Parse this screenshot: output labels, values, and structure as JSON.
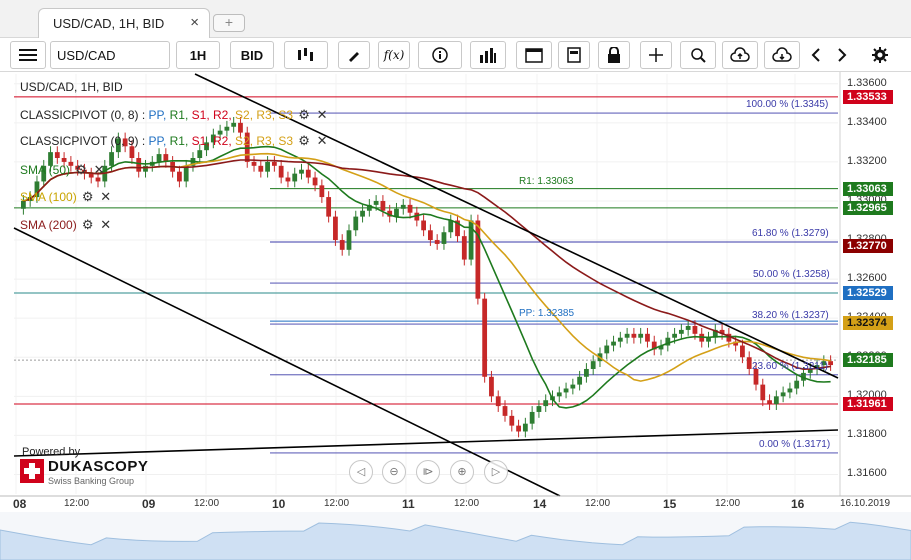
{
  "tab": {
    "label": "USD/CAD, 1H, BID",
    "close": "×",
    "add": "+"
  },
  "toolbar": {
    "instrument": "USD/CAD",
    "period": "1H",
    "side": "BID",
    "fx_label": "f(x)"
  },
  "legend": {
    "title": "USD/CAD, 1H, BID",
    "pivot1_name": "CLASSICPIVOT (0, 8)",
    "pivot2_name": "CLASSICPIVOT (0, 9)",
    "pivot_items": [
      "PP",
      "R1",
      "S1",
      "R2",
      "S2",
      "R3",
      "S3"
    ],
    "sma50": "SMA (50)",
    "sma100": "SMA (100)",
    "sma200": "SMA (200)"
  },
  "branding": {
    "powered_by": "Powered by",
    "brand": "DUKASCOPY",
    "sub": "Swiss Banking Group"
  },
  "annotations": {
    "fib100": "100.00 % (1.3345)",
    "fib618": "61.80 % (1.3279)",
    "fib50": "50.00 % (1.3258)",
    "fib382": "38.20 % (1.3237)",
    "fib236": "23.60 % (1.3211)",
    "fib0": "0.00 % (1.3171)",
    "r1": "R1: 1.33063",
    "pp": "PP: 1.32385"
  },
  "chart_data": {
    "type": "line",
    "title": "USD/CAD, 1H, BID",
    "ylim": [
      1.315,
      1.3365
    ],
    "y_ticks": [
      1.336,
      1.334,
      1.332,
      1.33,
      1.328,
      1.326,
      1.324,
      1.322,
      1.32,
      1.318,
      1.316
    ],
    "y_tick_labels": [
      "1.33600",
      "1.33400",
      "1.33200",
      "1.33000",
      "1.32800",
      "1.32600",
      "1.32400",
      "1.32200",
      "1.32000",
      "1.31800",
      "1.31600"
    ],
    "x_labels": [
      "08",
      "12:00",
      "09",
      "12:00",
      "10",
      "12:00",
      "11",
      "12:00",
      "14",
      "12:00",
      "15",
      "12:00",
      "16",
      "16.10.2019"
    ],
    "price_tags": [
      {
        "value": "1.33533",
        "color": "#d0021b"
      },
      {
        "value": "1.33063",
        "color": "#1e7a1e"
      },
      {
        "value": "1.32965",
        "color": "#1e7a1e"
      },
      {
        "value": "1.32770",
        "color": "#8b0000"
      },
      {
        "value": "1.32529",
        "color": "#1f6fc2"
      },
      {
        "value": "1.32374",
        "color": "#d4a017"
      },
      {
        "value": "1.32185",
        "color": "#1e7a1e"
      },
      {
        "value": "1.31961",
        "color": "#d0021b"
      }
    ],
    "levels": {
      "red_line": 1.33533,
      "r1": 1.33063,
      "green_line": 1.32965,
      "teal_line": 1.32529,
      "pp": 1.32385,
      "red_low": 1.31961
    },
    "fib": [
      1.3345,
      1.3279,
      1.3258,
      1.3237,
      1.3211,
      1.3171
    ],
    "close_series": [
      1.33,
      1.3302,
      1.331,
      1.3318,
      1.3325,
      1.3322,
      1.332,
      1.3318,
      1.3316,
      1.3314,
      1.3312,
      1.331,
      1.3318,
      1.3325,
      1.3332,
      1.3328,
      1.3322,
      1.3315,
      1.3318,
      1.332,
      1.3324,
      1.332,
      1.3315,
      1.331,
      1.3318,
      1.3322,
      1.3326,
      1.333,
      1.3334,
      1.3336,
      1.3338,
      1.334,
      1.3335,
      1.332,
      1.3318,
      1.3315,
      1.332,
      1.3318,
      1.3312,
      1.331,
      1.3314,
      1.3316,
      1.3312,
      1.3308,
      1.3302,
      1.3292,
      1.328,
      1.3275,
      1.3285,
      1.3292,
      1.3295,
      1.3298,
      1.33,
      1.3295,
      1.3292,
      1.3296,
      1.3298,
      1.3294,
      1.329,
      1.3285,
      1.328,
      1.3278,
      1.3284,
      1.329,
      1.3282,
      1.327,
      1.329,
      1.325,
      1.321,
      1.32,
      1.3195,
      1.319,
      1.3185,
      1.3182,
      1.3186,
      1.3192,
      1.3195,
      1.3198,
      1.32,
      1.3202,
      1.3204,
      1.3206,
      1.321,
      1.3214,
      1.3218,
      1.3222,
      1.3226,
      1.3228,
      1.323,
      1.3232,
      1.323,
      1.3232,
      1.3228,
      1.3224,
      1.3226,
      1.323,
      1.3232,
      1.3234,
      1.3236,
      1.3232,
      1.3228,
      1.323,
      1.3234,
      1.3232,
      1.3228,
      1.3226,
      1.322,
      1.3214,
      1.3206,
      1.3198,
      1.3196,
      1.32,
      1.3202,
      1.3204,
      1.3208,
      1.3212,
      1.3214,
      1.3216,
      1.3218,
      1.3216
    ]
  }
}
